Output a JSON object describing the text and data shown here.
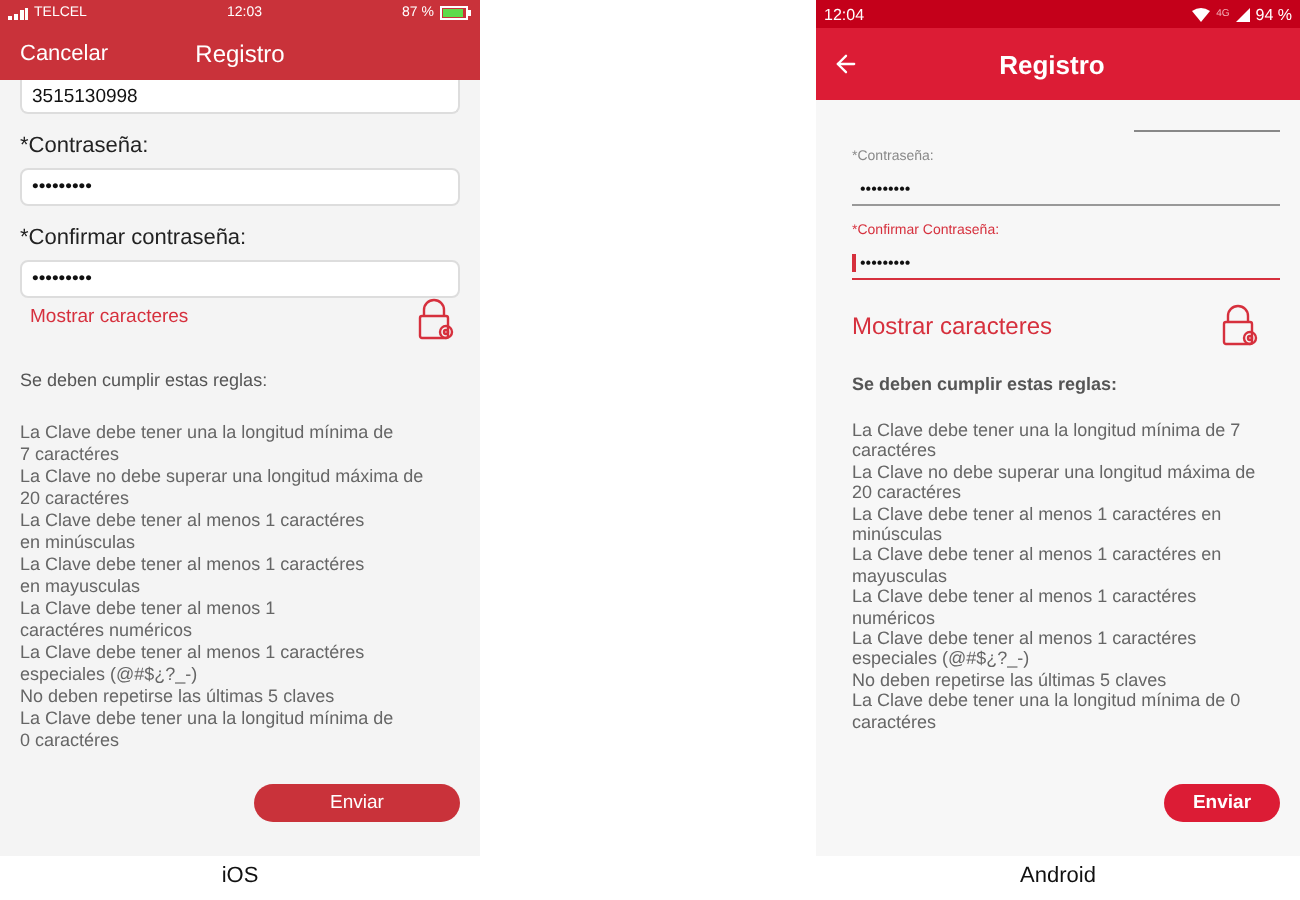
{
  "ios": {
    "caption": "iOS",
    "status_bar": {
      "carrier": "TELCEL",
      "time": "12:03",
      "battery": "87 %"
    },
    "nav": {
      "left": "Cancelar",
      "title": "Registro"
    },
    "phone_field": {
      "value": "3515130998"
    },
    "fields": [
      {
        "label": "*Contraseña:",
        "value": "•••••••••"
      },
      {
        "label": "*Confirmar contraseña:",
        "value": "•••••••••"
      }
    ],
    "show_chars": "Mostrar caracteres",
    "rules_title": "Se deben cumplir estas reglas:",
    "rules": [
      "La Clave debe tener una la longitud mínima de\n7 caractéres",
      "La Clave no debe superar una longitud máxima de\n20 caractéres",
      "La Clave debe tener al menos 1 caractéres\nen minúsculas",
      "La Clave debe tener al menos 1 caractéres\nen mayusculas",
      "La Clave debe tener al menos 1\ncaractéres numéricos",
      "La Clave debe tener al menos 1 caractéres\nespeciales (@#$¿?_-)",
      "No deben repetirse las últimas 5 claves",
      "La Clave debe tener una la longitud mínima de\n0 caractéres"
    ],
    "submit": "Enviar"
  },
  "android": {
    "caption": "Android",
    "status_bar": {
      "time": "12:04",
      "network": "4G",
      "battery": "94 %"
    },
    "app_bar": {
      "title": "Registro"
    },
    "fields": [
      {
        "label": "*Contraseña:",
        "value": "•••••••••",
        "focused": false
      },
      {
        "label": "*Confirmar Contraseña:",
        "value": "•••••••••",
        "focused": true
      }
    ],
    "show_chars": "Mostrar caracteres",
    "rules_title": "Se deben cumplir estas reglas:",
    "rules": [
      "La Clave debe tener una la longitud mínima de 7\ncaractéres",
      "La Clave no debe superar una longitud máxima de\n20 caractéres",
      "La Clave debe tener al menos 1 caractéres en\nminúsculas",
      "La Clave debe tener al menos 1 caractéres en\nmayusculas",
      "La Clave debe tener al menos 1 caractéres\nnuméricos",
      "La Clave debe tener al menos 1 caractéres\nespeciales (@#$¿?_-)",
      "No deben repetirse las últimas 5 claves",
      "La Clave debe tener una la longitud mínima de 0\ncaractéres"
    ],
    "submit": "Enviar"
  }
}
